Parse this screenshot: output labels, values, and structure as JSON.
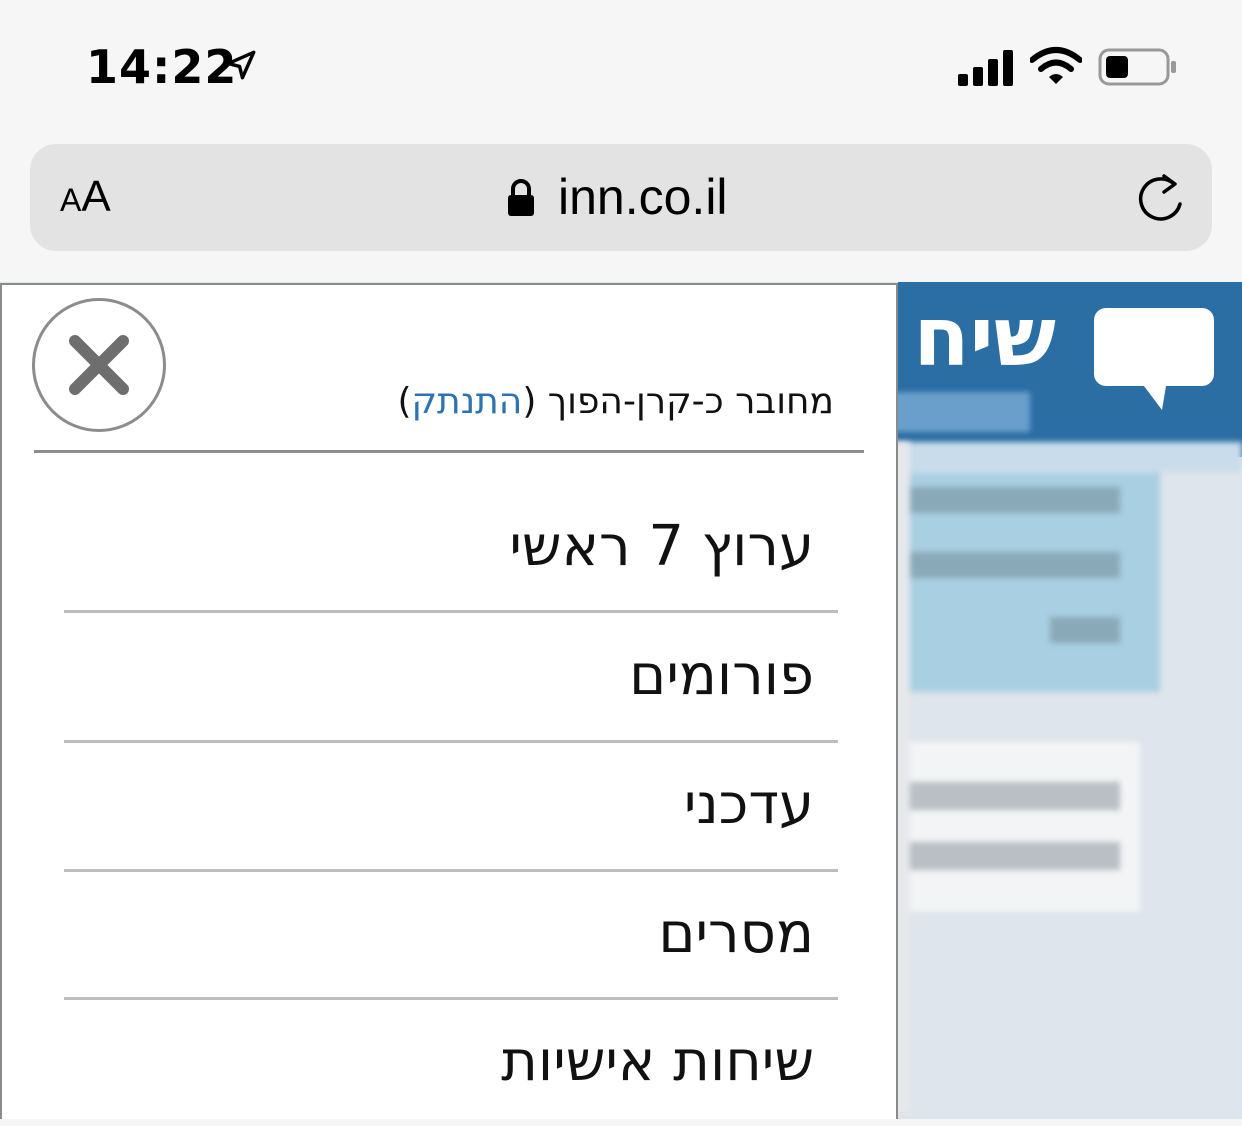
{
  "status_bar": {
    "time": "14:22",
    "icons": [
      "location-arrow-icon",
      "cellular-signal-icon",
      "wifi-icon",
      "battery-icon"
    ]
  },
  "browser": {
    "text_size_label": "AA",
    "url": "inn.co.il",
    "icons": [
      "lock-icon",
      "reload-icon"
    ]
  },
  "site": {
    "title_partial": "שיח",
    "header_color": "#2b6ea4",
    "icon": "chat-bubble-icon"
  },
  "menu": {
    "login_prefix": "מחובר כ-קרן-הפוך (",
    "logout_label": "התנתק",
    "login_suffix": ")",
    "close_icon": "close-icon",
    "items": [
      {
        "label": "ערוץ 7 ראשי"
      },
      {
        "label": "פורומים"
      },
      {
        "label": "עדכני"
      },
      {
        "label": "מסרים"
      },
      {
        "label": "שיחות אישיות"
      }
    ],
    "link_color": "#2d73b0"
  }
}
